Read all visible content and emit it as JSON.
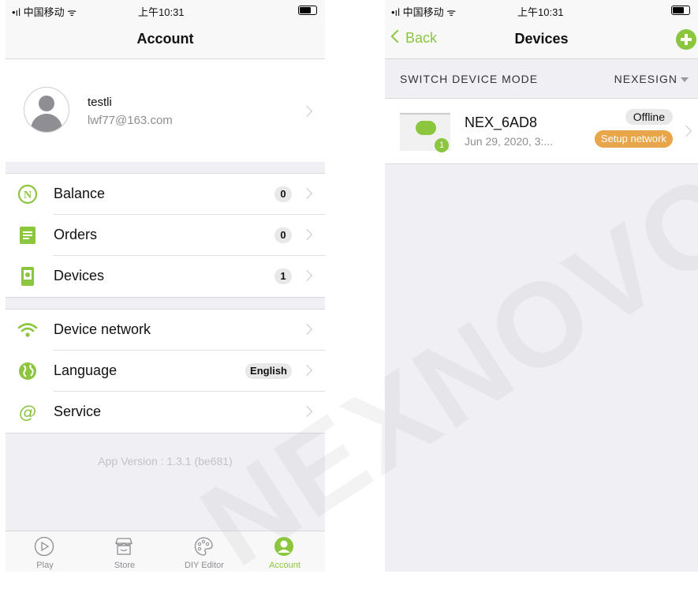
{
  "left": {
    "status": {
      "signal": "•ıl 中国移动 ᯤ",
      "time": "上午10:31"
    },
    "nav": {
      "title": "Account"
    },
    "profile": {
      "name": "testli",
      "email": "lwf77@163.com"
    },
    "menu1": [
      {
        "label": "Balance",
        "icon": "balance-icon",
        "badge": "0"
      },
      {
        "label": "Orders",
        "icon": "orders-icon",
        "badge": "0"
      },
      {
        "label": "Devices",
        "icon": "devices-icon",
        "badge": "1"
      }
    ],
    "menu2": [
      {
        "label": "Device network",
        "icon": "wifi-icon",
        "badge": ""
      },
      {
        "label": "Language",
        "icon": "globe-icon",
        "badge": "English"
      },
      {
        "label": "Service",
        "icon": "at-sign-icon",
        "badge": ""
      }
    ],
    "version": "App Version : 1.3.1 (be681)",
    "tabs": [
      {
        "label": "Play",
        "icon": "play-icon"
      },
      {
        "label": "Store",
        "icon": "store-icon"
      },
      {
        "label": "DIY Editor",
        "icon": "palette-icon"
      },
      {
        "label": "Account",
        "icon": "account-icon",
        "active": true
      }
    ]
  },
  "right": {
    "status": {
      "signal": "•ıl 中国移动 ᯤ",
      "time": "上午10:31"
    },
    "nav": {
      "back": "Back",
      "title": "Devices"
    },
    "mode": {
      "label": "SWITCH DEVICE MODE",
      "value": "NEXESIGN"
    },
    "device": {
      "name": "NEX_6AD8",
      "date": "Jun 29, 2020, 3:...",
      "status": "Offline",
      "action": "Setup network",
      "count": "1"
    }
  },
  "watermark": "NEXNOVO",
  "colors": {
    "accent": "#8cc63f",
    "setup": "#e9a54a"
  }
}
